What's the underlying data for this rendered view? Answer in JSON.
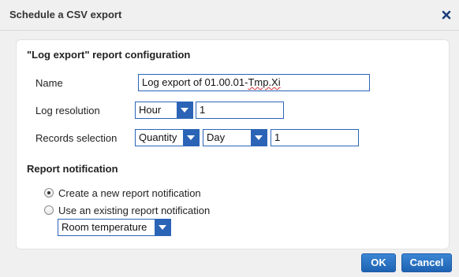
{
  "dialog": {
    "title": "Schedule a CSV export",
    "close_icon": "close-icon"
  },
  "config": {
    "heading": "\"Log export\" report configuration",
    "name_label": "Name",
    "name_value": "Log export of 01.00.01-Tmp.Xi",
    "name_value_plain": "Log export of 01.00.01-",
    "name_value_underlined": "Tmp.Xi",
    "resolution_label": "Log resolution",
    "resolution_unit": "Hour",
    "resolution_value": "1",
    "records_label": "Records selection",
    "records_mode": "Quantity",
    "records_period": "Day",
    "records_value": "1"
  },
  "notification": {
    "heading": "Report notification",
    "options": [
      {
        "label": "Create a new report notification",
        "checked": true
      },
      {
        "label": "Use an existing report notification",
        "checked": false
      }
    ],
    "existing_selected": "Room temperature"
  },
  "buttons": {
    "ok": "OK",
    "cancel": "Cancel"
  },
  "colors": {
    "accent": "#2b64b7",
    "button": "#1f63b3"
  }
}
